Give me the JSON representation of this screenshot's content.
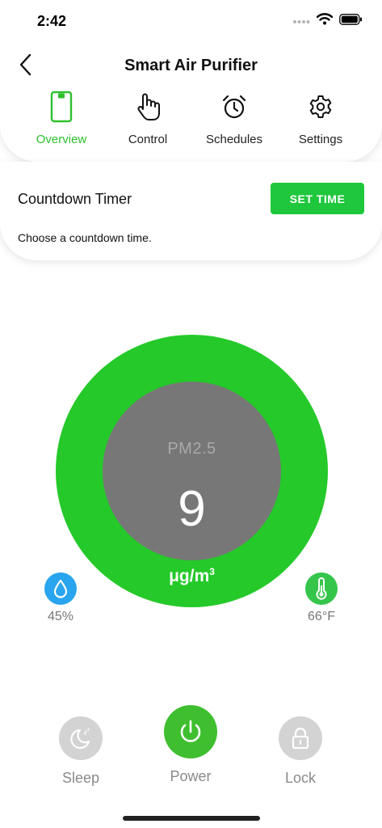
{
  "status_bar": {
    "time": "2:42"
  },
  "header": {
    "title": "Smart Air Purifier"
  },
  "tabs": [
    {
      "label": "Overview",
      "icon": "phone-device-icon",
      "active": true
    },
    {
      "label": "Control",
      "icon": "hand-pointer-icon",
      "active": false
    },
    {
      "label": "Schedules",
      "icon": "alarm-clock-icon",
      "active": false
    },
    {
      "label": "Settings",
      "icon": "gear-icon",
      "active": false
    }
  ],
  "timer": {
    "title": "Countdown Timer",
    "description": "Choose a countdown time.",
    "button_label": "SET TIME"
  },
  "gauge": {
    "label": "PM2.5",
    "value": "9",
    "unit": "μg/m",
    "unit_superscript": "3"
  },
  "sensors": {
    "humidity": {
      "value": "45%",
      "icon": "water-drop-icon"
    },
    "temperature": {
      "value": "66°F",
      "icon": "thermometer-icon"
    }
  },
  "controls": {
    "sleep": {
      "label": "Sleep",
      "icon": "moon-sleep-icon"
    },
    "power": {
      "label": "Power",
      "icon": "power-icon"
    },
    "lock": {
      "label": "Lock",
      "icon": "lock-icon"
    }
  },
  "colors": {
    "accent_green": "#1fc73d",
    "gauge_ring": "#25c92a",
    "gauge_center": "#777777",
    "humidity_blue": "#29a4ee",
    "temperature_green": "#34c54a",
    "inactive_gray": "#d3d3d3"
  }
}
